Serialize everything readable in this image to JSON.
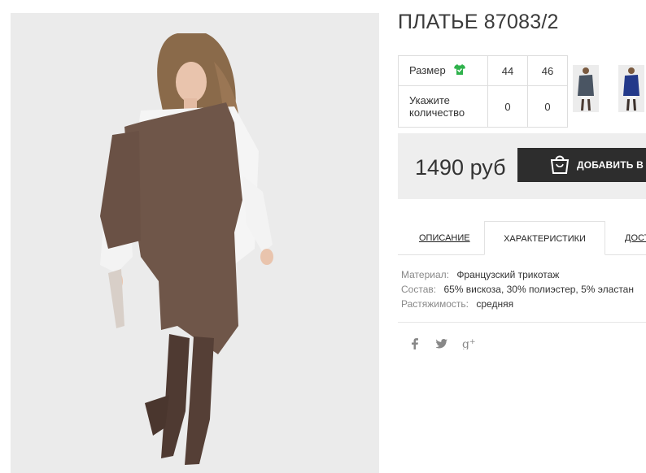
{
  "product": {
    "title": "ПЛАТЬЕ 87083/2"
  },
  "sizes": {
    "size_label": "Размер",
    "qty_label_line1": "Укажите",
    "qty_label_line2": "количество",
    "columns": [
      "44",
      "46"
    ],
    "quantities": [
      "0",
      "0"
    ]
  },
  "thumbnails": [
    {
      "name": "gray-dress-thumbnail"
    },
    {
      "name": "blue-dress-thumbnail"
    }
  ],
  "price": {
    "amount": "1490 руб",
    "add_to_cart": "ДОБАВИТЬ В ЗАКАЗ"
  },
  "tabs": {
    "items": [
      {
        "label": "ОПИСАНИЕ"
      },
      {
        "label": "ХАРАКТЕРИСТИКИ",
        "active": true
      },
      {
        "label": "ДОСТАВКА"
      }
    ]
  },
  "specs": [
    {
      "key": "Материал:",
      "value": "Французский трикотаж"
    },
    {
      "key": "Состав:",
      "value": "65% вискоза, 30% полиэстер, 5% эластан"
    },
    {
      "key": "Растяжимость:",
      "value": "средняя"
    }
  ],
  "social": {
    "facebook": "f",
    "twitter": "twitter-bird",
    "google_plus": "g+"
  },
  "colors": {
    "button_bg": "#2d2d2d",
    "size_icon": "#2fb24c",
    "panel_bg": "#eeeeee"
  }
}
